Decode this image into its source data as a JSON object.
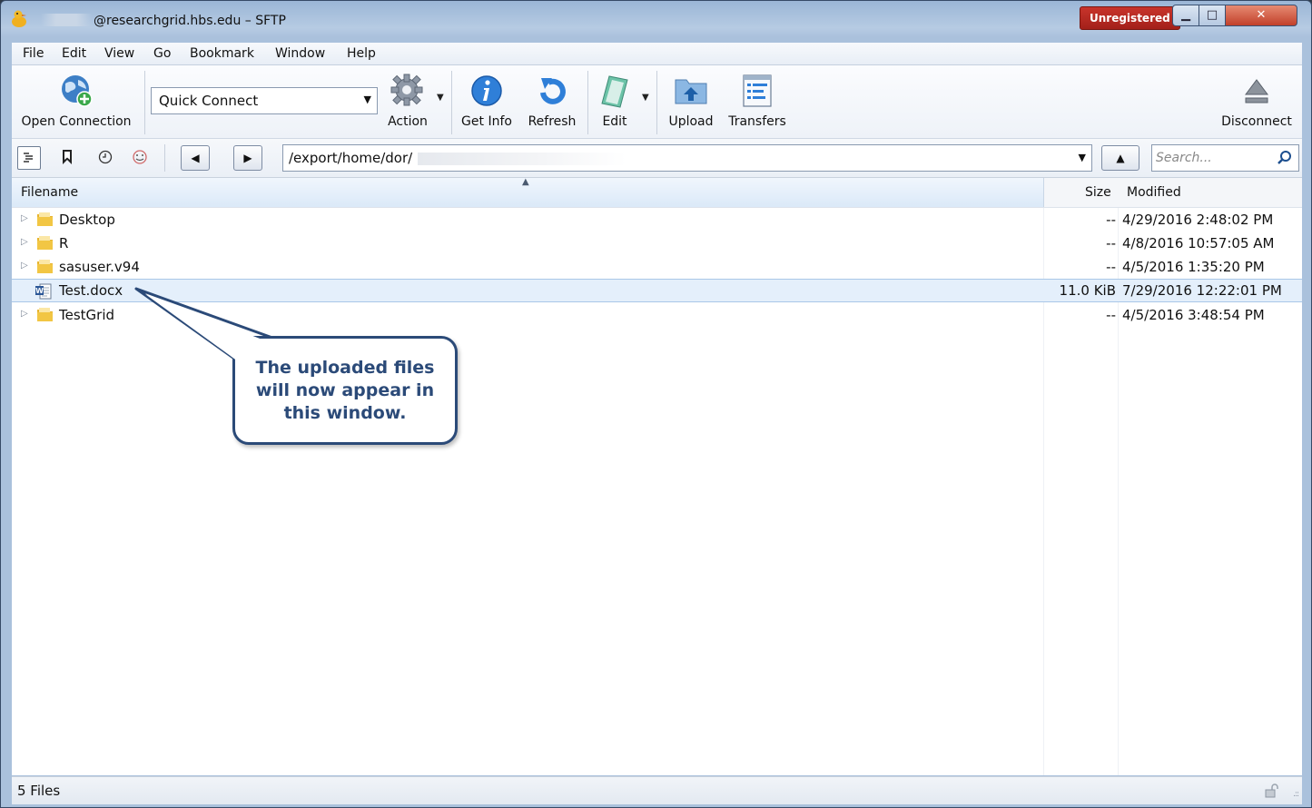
{
  "window": {
    "title": "@researchgrid.hbs.edu – SFTP",
    "unregistered_badge": "Unregistered"
  },
  "menu": [
    "File",
    "Edit",
    "View",
    "Go",
    "Bookmark",
    "Window",
    "Help"
  ],
  "toolbar": {
    "open_connection": "Open Connection",
    "quick_connect": "Quick Connect",
    "action": "Action",
    "get_info": "Get Info",
    "refresh": "Refresh",
    "edit": "Edit",
    "upload": "Upload",
    "transfers": "Transfers",
    "disconnect": "Disconnect"
  },
  "navigation": {
    "path": "/export/home/dor/",
    "search_placeholder": "Search..."
  },
  "file_list": {
    "columns": {
      "filename": "Filename",
      "size": "Size",
      "modified": "Modified"
    },
    "rows": [
      {
        "name": "Desktop",
        "type": "folder",
        "size": "--",
        "modified": "4/29/2016 2:48:02 PM",
        "selected": false
      },
      {
        "name": "R",
        "type": "folder",
        "size": "--",
        "modified": "4/8/2016 10:57:05 AM",
        "selected": false
      },
      {
        "name": "sasuser.v94",
        "type": "folder",
        "size": "--",
        "modified": "4/5/2016 1:35:20 PM",
        "selected": false
      },
      {
        "name": "Test.docx",
        "type": "word-document",
        "size": "11.0 KiB",
        "modified": "7/29/2016 12:22:01 PM",
        "selected": true
      },
      {
        "name": "TestGrid",
        "type": "folder",
        "size": "--",
        "modified": "4/5/2016 3:48:54 PM",
        "selected": false
      }
    ]
  },
  "callout": {
    "lines": [
      "The uploaded files",
      "will now appear in",
      "this window."
    ]
  },
  "status": {
    "file_count": "5 Files"
  },
  "colors": {
    "callout_border": "#2b4a78",
    "selection": "#e4effb",
    "unregistered": "#b8281f"
  }
}
